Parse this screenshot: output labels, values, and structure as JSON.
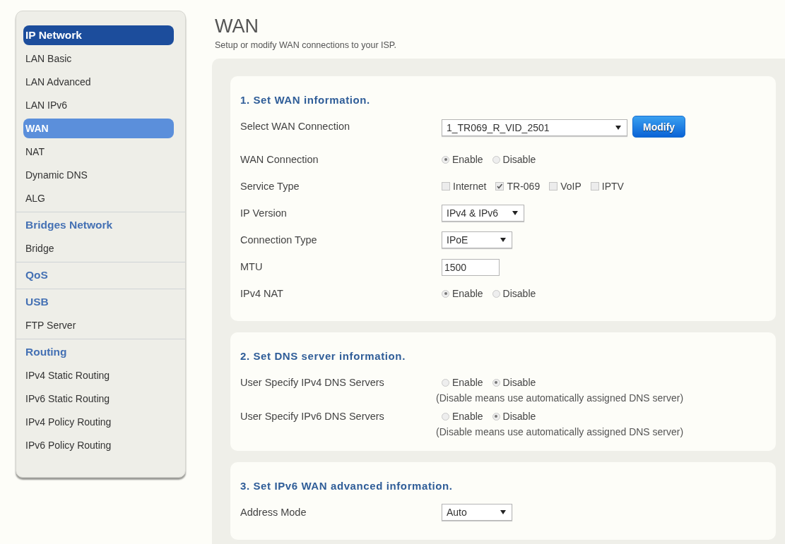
{
  "sidebar": {
    "sections": [
      {
        "heading": {
          "label": "IP Network",
          "selected": true
        },
        "items": [
          {
            "label": "LAN Basic",
            "selected": false
          },
          {
            "label": "LAN Advanced",
            "selected": false
          },
          {
            "label": "LAN IPv6",
            "selected": false
          },
          {
            "label": "WAN",
            "selected": true
          },
          {
            "label": "NAT",
            "selected": false
          },
          {
            "label": "Dynamic DNS",
            "selected": false
          },
          {
            "label": "ALG",
            "selected": false
          }
        ]
      },
      {
        "heading": {
          "label": "Bridges Network",
          "selected": false
        },
        "items": [
          {
            "label": "Bridge",
            "selected": false
          }
        ]
      },
      {
        "heading": {
          "label": "QoS",
          "selected": false
        }
      },
      {
        "heading": {
          "label": "USB",
          "selected": false
        },
        "items": [
          {
            "label": "FTP Server",
            "selected": false
          }
        ]
      },
      {
        "heading": {
          "label": "Routing",
          "selected": false
        },
        "items": [
          {
            "label": "IPv4 Static Routing",
            "selected": false
          },
          {
            "label": "IPv6 Static Routing",
            "selected": false
          },
          {
            "label": "IPv4 Policy Routing",
            "selected": false
          },
          {
            "label": "IPv6 Policy Routing",
            "selected": false
          }
        ]
      }
    ]
  },
  "page": {
    "title": "WAN",
    "subtitle": "Setup or modify WAN connections to your ISP."
  },
  "cards": [
    {
      "heading": "1. Set WAN information.",
      "fields": [
        {
          "kind": "select",
          "label": "Select WAN Connection",
          "value": "1_TR069_R_VID_2501",
          "button": "Modify"
        },
        {
          "kind": "radio",
          "label": "WAN Connection",
          "options": [
            {
              "label": "Enable",
              "selected": true
            },
            {
              "label": "Disable",
              "selected": false
            }
          ]
        },
        {
          "kind": "checkbox",
          "label": "Service Type",
          "options": [
            {
              "label": "Internet",
              "checked": false
            },
            {
              "label": "TR-069",
              "checked": true
            },
            {
              "label": "VoIP",
              "checked": false
            },
            {
              "label": "IPTV",
              "checked": false
            }
          ]
        },
        {
          "kind": "select",
          "label": "IP Version",
          "value": "IPv4 & IPv6"
        },
        {
          "kind": "select",
          "label": "Connection Type",
          "value": "IPoE"
        },
        {
          "kind": "text",
          "label": "MTU",
          "value": "1500"
        },
        {
          "kind": "radio",
          "label": "IPv4 NAT",
          "options": [
            {
              "label": "Enable",
              "selected": true
            },
            {
              "label": "Disable",
              "selected": false
            }
          ]
        }
      ]
    },
    {
      "heading": "2. Set DNS server information.",
      "fields": [
        {
          "kind": "radio",
          "label": "User Specify IPv4 DNS Servers",
          "options": [
            {
              "label": "Enable",
              "selected": false
            },
            {
              "label": "Disable",
              "selected": true
            }
          ],
          "note": "(Disable means use automatically assigned DNS server)"
        },
        {
          "kind": "radio",
          "label": "User Specify IPv6 DNS Servers",
          "options": [
            {
              "label": "Enable",
              "selected": false
            },
            {
              "label": "Disable",
              "selected": true
            }
          ],
          "note": "(Disable means use automatically assigned DNS server)"
        }
      ]
    },
    {
      "heading": "3. Set IPv6 WAN advanced information.",
      "fields": [
        {
          "kind": "select",
          "label": "Address Mode",
          "value": "Auto"
        }
      ]
    }
  ]
}
